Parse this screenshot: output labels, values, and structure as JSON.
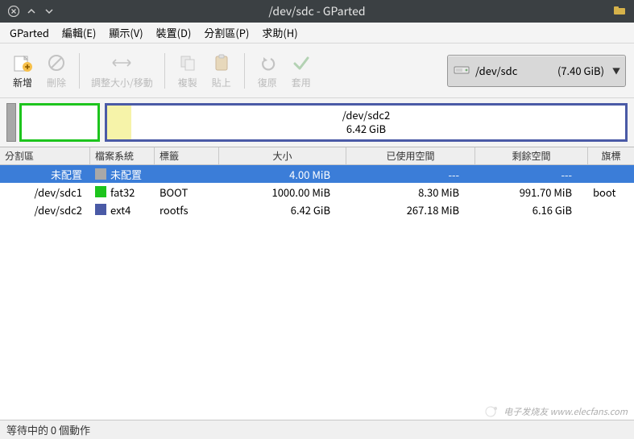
{
  "window": {
    "title": "/dev/sdc - GParted"
  },
  "menu": {
    "gparted": "GParted",
    "edit": "編輯(E)",
    "view": "顯示(V)",
    "device": "裝置(D)",
    "partition": "分割區(P)",
    "help": "求助(H)"
  },
  "toolbar": {
    "new": "新增",
    "delete": "刪除",
    "resize": "調整大小/移動",
    "copy": "複製",
    "paste": "貼上",
    "undo": "復原",
    "apply": "套用"
  },
  "device_selector": {
    "name": "/dev/sdc",
    "size": "(7.40 GiB)"
  },
  "diskmap": {
    "sdc2_name": "/dev/sdc2",
    "sdc2_size": "6.42 GiB"
  },
  "columns": {
    "partition": "分割區",
    "filesystem": "檔案系統",
    "label": "標籤",
    "size": "大小",
    "used": "已使用空間",
    "unused": "剩餘空間",
    "flags": "旗標"
  },
  "rows": [
    {
      "partition": "未配置",
      "fs": "未配置",
      "fs_class": "sw-unalloc",
      "label": "",
      "size": "4.00 MiB",
      "used": "---",
      "unused": "---",
      "flags": ""
    },
    {
      "partition": "/dev/sdc1",
      "fs": "fat32",
      "fs_class": "sw-fat32",
      "label": "BOOT",
      "size": "1000.00 MiB",
      "used": "8.30 MiB",
      "unused": "991.70 MiB",
      "flags": "boot"
    },
    {
      "partition": "/dev/sdc2",
      "fs": "ext4",
      "fs_class": "sw-ext4",
      "label": "rootfs",
      "size": "6.42 GiB",
      "used": "267.18 MiB",
      "unused": "6.16 GiB",
      "flags": ""
    }
  ],
  "status": "等待中的 0 個動作",
  "watermark": "电子发烧友 www.elecfans.com"
}
